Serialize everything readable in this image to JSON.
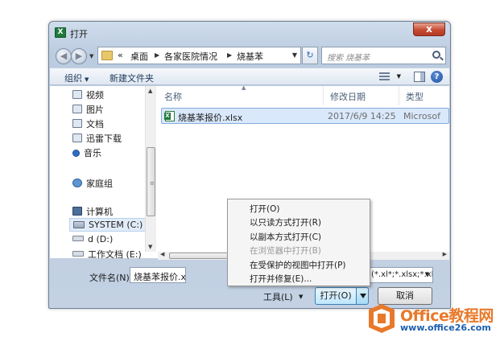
{
  "window": {
    "title": "打开",
    "close_label": "x"
  },
  "address": {
    "segments": [
      "«",
      "桌面",
      "各家医院情况",
      "烧基苯"
    ],
    "refresh_label": "↻"
  },
  "search": {
    "placeholder": "搜索 烧基苯"
  },
  "toolbar": {
    "organize_label": "组织",
    "new_folder_label": "新建文件夹",
    "help_label": "?"
  },
  "nav_pane": {
    "items": [
      {
        "label": "视频",
        "icon": "video-icon"
      },
      {
        "label": "图片",
        "icon": "picture-icon"
      },
      {
        "label": "文档",
        "icon": "document-icon"
      },
      {
        "label": "迅雷下载",
        "icon": "download-icon"
      },
      {
        "label": "音乐",
        "icon": "music-icon"
      },
      {
        "label": "家庭组",
        "icon": "homegroup-icon"
      },
      {
        "label": "计算机",
        "icon": "computer-icon"
      },
      {
        "label": "SYSTEM (C:)",
        "icon": "drive-icon"
      },
      {
        "label": "d (D:)",
        "icon": "drive-icon"
      },
      {
        "label": "工作文档 (E:)",
        "icon": "drive-icon"
      }
    ]
  },
  "file_list": {
    "columns": [
      "名称",
      "修改日期",
      "类型"
    ],
    "rows": [
      {
        "name": "烧基苯报价.xlsx",
        "modified": "2017/6/9 14:25",
        "type": "Microsof"
      }
    ]
  },
  "bottom": {
    "filename_label": "文件名(N):",
    "filename_value": "烧基苯报价.xlsx",
    "filetype_value": "(*.xl*;*.xlsx;*.xl",
    "tools_label": "工具(L)",
    "open_label": "打开(O)",
    "cancel_label": "取消"
  },
  "open_menu": {
    "items": [
      {
        "label": "打开(O)",
        "enabled": true
      },
      {
        "label": "以只读方式打开(R)",
        "enabled": true
      },
      {
        "label": "以副本方式打开(C)",
        "enabled": true
      },
      {
        "label": "在浏览器中打开(B)",
        "enabled": false
      },
      {
        "label": "在受保护的视图中打开(P)",
        "enabled": true
      },
      {
        "label": "打开并修复(E)...",
        "enabled": true
      }
    ]
  },
  "watermark": {
    "title": "Office教程网",
    "url": "www.office26.com"
  },
  "colors": {
    "accent": "#3c7fb1",
    "selection": "#d9e8fb",
    "close": "#c74a33",
    "brand_orange": "#e8792a",
    "brand_blue": "#1c5fb0"
  }
}
